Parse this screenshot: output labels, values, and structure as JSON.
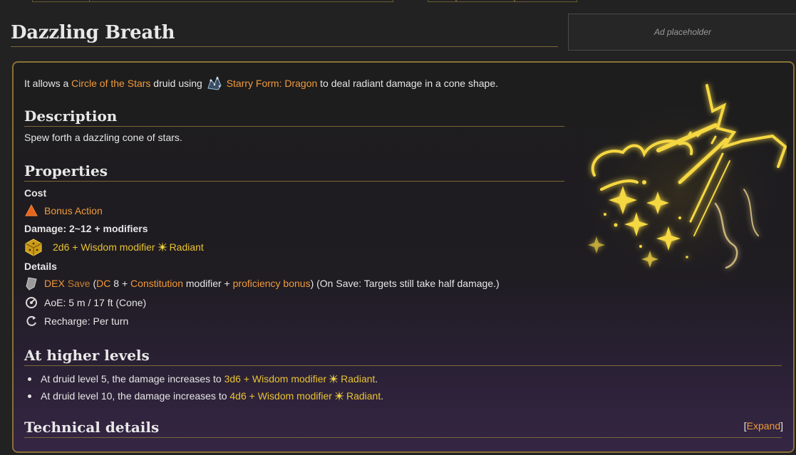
{
  "page": {
    "title": "Dazzling Breath",
    "ad_text": "Ad placeholder"
  },
  "intro": {
    "prefix": "It allows a",
    "subclass_link": "Circle of the Stars",
    "middle": "druid using",
    "form_link": "Starry Form: Dragon",
    "suffix": "to deal radiant damage in a cone shape."
  },
  "description": {
    "heading": "Description",
    "text": "Spew forth a dazzling cone of stars."
  },
  "properties": {
    "heading": "Properties",
    "cost_label": "Cost",
    "cost_value": "Bonus Action",
    "damage_label": "Damage: 2~12 + modifiers",
    "damage_dice_link": "2d6 + Wisdom modifier",
    "damage_type": "Radiant",
    "details_label": "Details",
    "save_ability": "DEX",
    "save_link": "Save",
    "save_paren_open": "(",
    "save_dc": "DC",
    "save_dc_value": "8 +",
    "save_con": "Constitution",
    "save_mod": "modifier +",
    "save_prof": "proficiency bonus",
    "save_rest": ") (On Save: Targets still take half damage.)",
    "aoe": "AoE: 5 m / 17 ft (Cone)",
    "recharge": "Recharge: Per turn"
  },
  "higher_levels": {
    "heading": "At higher levels",
    "items": [
      {
        "prefix": "At druid level 5, the damage increases to",
        "dice": "3d6 + Wisdom modifier",
        "type": "Radiant",
        "end": "."
      },
      {
        "prefix": "At druid level 10, the damage increases to",
        "dice": "4d6 + Wisdom modifier",
        "type": "Radiant",
        "end": "."
      }
    ]
  },
  "technical": {
    "heading": "Technical details",
    "expand_open": "[",
    "expand_label": "Expand",
    "expand_close": "]"
  },
  "colors": {
    "link": "#f19a3a",
    "gold": "#e9c232",
    "border": "#8a7035"
  }
}
